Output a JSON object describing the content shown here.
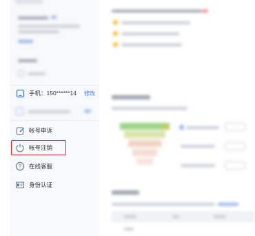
{
  "sidebar": {
    "items": [
      {
        "icon": "phone-icon",
        "label": "手机：150******14",
        "action": "修改"
      },
      {
        "icon": "edit-icon",
        "label": "帐号申诉"
      },
      {
        "icon": "power-icon",
        "label": "帐号注销"
      },
      {
        "icon": "help-icon",
        "label": "在线客服"
      },
      {
        "icon": "id-card-icon",
        "label": "身份认证"
      }
    ]
  },
  "colors": {
    "accent_blue": "#3b7be0",
    "highlight_red": "#e02424",
    "icon_gray": "#6b7280",
    "funnel": [
      "#9ed48a",
      "#d9e4a8",
      "#f3d2c4",
      "#f7e0dc"
    ]
  }
}
